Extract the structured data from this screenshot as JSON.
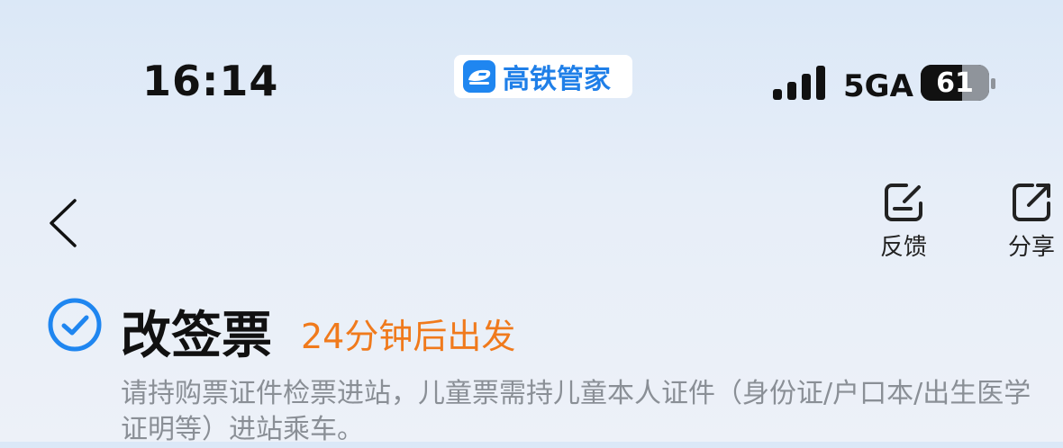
{
  "status_bar": {
    "time": "16:14",
    "app_name": "高铁管家",
    "network": "5GA",
    "battery": "61",
    "battery_level": 0.61
  },
  "nav": {
    "feedback_label": "反馈",
    "share_label": "分享"
  },
  "ticket": {
    "title": "改签票",
    "departure_note": "24分钟后出发",
    "notice": "请持购票证件检票进站，儿童票需持儿童本人证件（身份证/户口本/出生医学证明等）进站乘车。"
  },
  "colors": {
    "accent_blue": "#1f86f0",
    "accent_orange": "#f07a1c"
  }
}
